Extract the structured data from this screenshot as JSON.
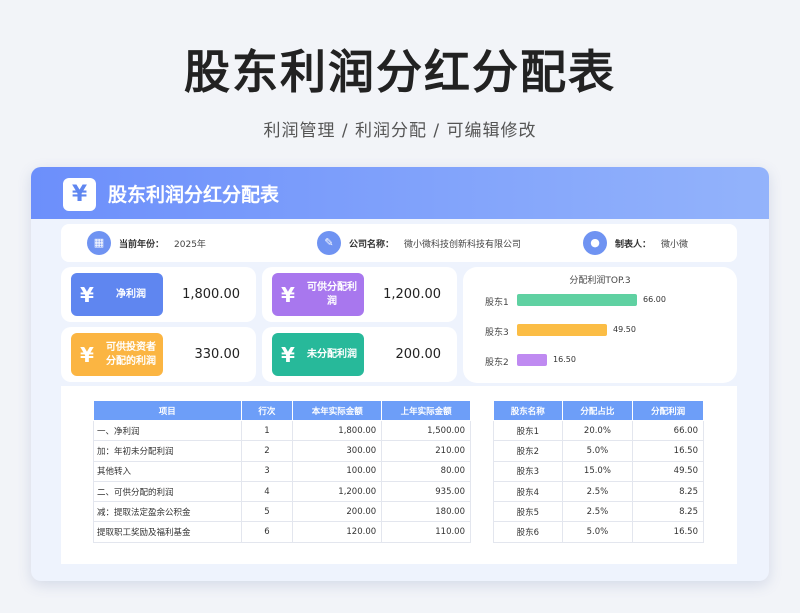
{
  "title": "股东利润分红分配表",
  "subtitle": "利润管理 / 利润分配 /  可编辑修改",
  "card": {
    "header_title": "股东利润分红分配表",
    "header_icon": "yen-icon"
  },
  "info": {
    "year_label": "当前年份：",
    "year_value": "2025年",
    "company_label": "公司名称：",
    "company_value": "微小微科技创新科技有限公司",
    "maker_label": "制表人：",
    "maker_value": "微小微"
  },
  "stats": [
    {
      "label": "净利润",
      "value": "1,800.00",
      "color": "#5f86f0"
    },
    {
      "label": "可供分配利润",
      "value": "1,200.00",
      "color": "#a877ee"
    },
    {
      "label": "可供投资者分配的利润",
      "value": "330.00",
      "color": "#fbb542"
    },
    {
      "label": "未分配利润",
      "value": "200.00",
      "color": "#27b99a"
    }
  ],
  "top3": {
    "title": "分配利润TOP.3",
    "items": [
      {
        "name": "股东1",
        "value": "66.00",
        "amount": 66.0,
        "color": "#5fd1a2"
      },
      {
        "name": "股东3",
        "value": "49.50",
        "amount": 49.5,
        "color": "#fbbd45"
      },
      {
        "name": "股东2",
        "value": "16.50",
        "amount": 16.5,
        "color": "#bf8af1"
      }
    ]
  },
  "profit_table": {
    "headers": [
      "项目",
      "行次",
      "本年实际金额",
      "上年实际金额"
    ],
    "rows": [
      [
        "一、净利润",
        "1",
        "1,800.00",
        "1,500.00"
      ],
      [
        "加：年初未分配利润",
        "2",
        "300.00",
        "210.00"
      ],
      [
        "其他转入",
        "3",
        "100.00",
        "80.00"
      ],
      [
        "二、可供分配的利润",
        "4",
        "1,200.00",
        "935.00"
      ],
      [
        "减：提取法定盈余公积金",
        "5",
        "200.00",
        "180.00"
      ],
      [
        "提取职工奖励及福利基金",
        "6",
        "120.00",
        "110.00"
      ]
    ]
  },
  "shareholder_table": {
    "headers": [
      "股东名称",
      "分配占比",
      "分配利润"
    ],
    "rows": [
      [
        "股东1",
        "20.0%",
        "66.00"
      ],
      [
        "股东2",
        "5.0%",
        "16.50"
      ],
      [
        "股东3",
        "15.0%",
        "49.50"
      ],
      [
        "股东4",
        "2.5%",
        "8.25"
      ],
      [
        "股东5",
        "2.5%",
        "8.25"
      ],
      [
        "股东6",
        "5.0%",
        "16.50"
      ]
    ]
  }
}
